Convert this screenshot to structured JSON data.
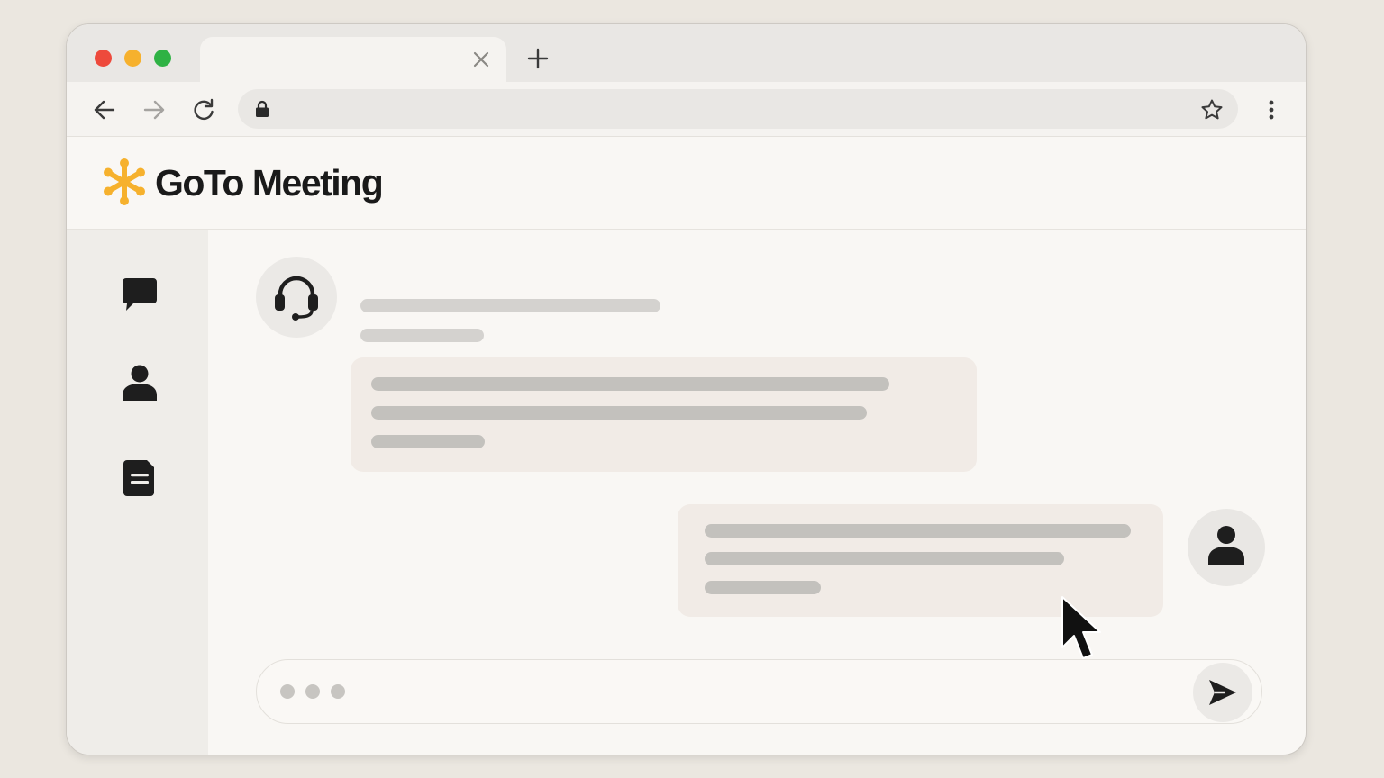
{
  "browser": {
    "tab_title": "",
    "address": "",
    "icons": [
      "close-icon",
      "plus-icon",
      "back-arrow-icon",
      "forward-arrow-icon",
      "reload-icon",
      "lock-icon",
      "star-icon",
      "kebab-menu-icon"
    ]
  },
  "app": {
    "name": "GoTo Meeting",
    "brand_color": "#f6b12d"
  },
  "sidebar": {
    "items": [
      {
        "icon": "chat-bubble-icon"
      },
      {
        "icon": "person-icon"
      },
      {
        "icon": "document-icon"
      }
    ]
  },
  "chat": {
    "agent_avatar_icon": "headset-icon",
    "user_avatar_icon": "person-icon",
    "composer_icon": "send-icon"
  },
  "colors": {
    "traffic_red": "#ee4a3c",
    "traffic_yellow": "#f6b12d",
    "traffic_green": "#2fb244"
  }
}
